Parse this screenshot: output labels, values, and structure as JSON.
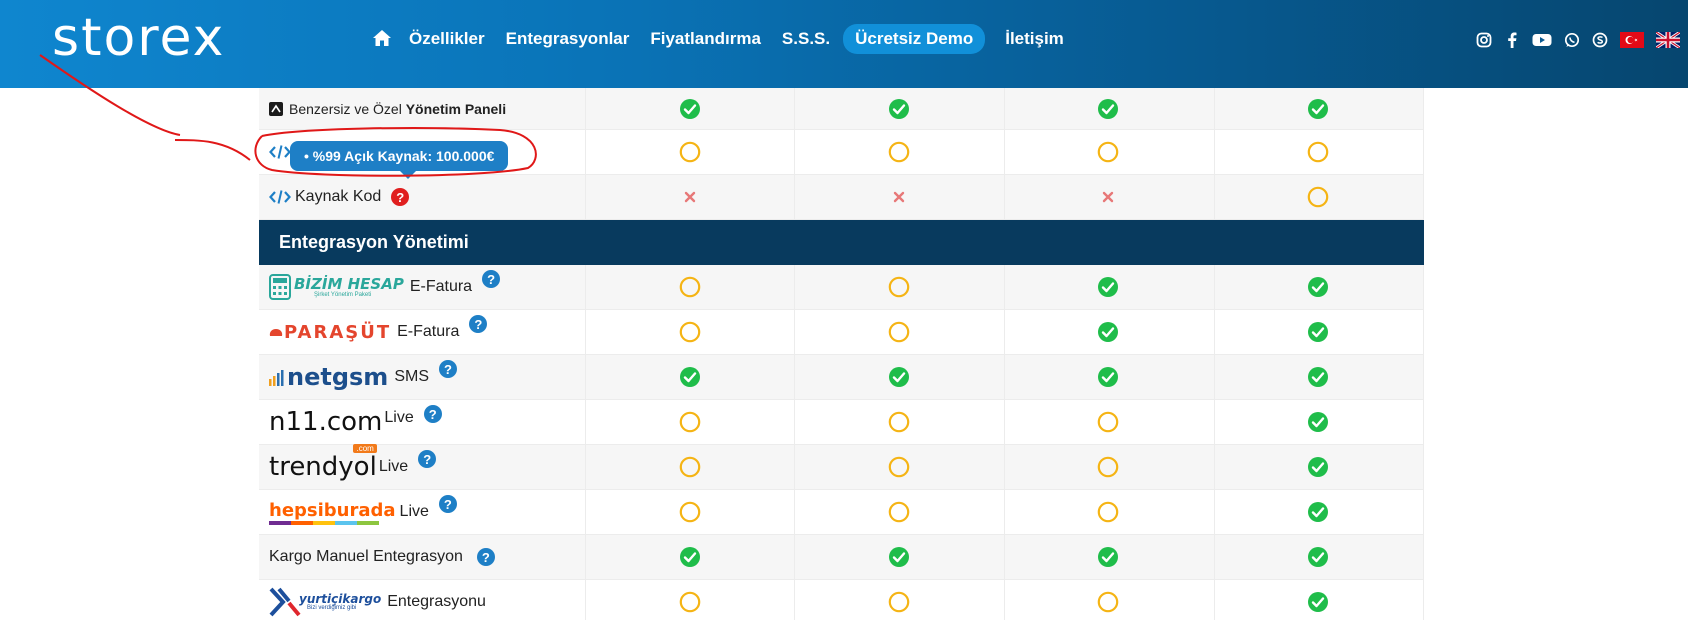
{
  "header": {
    "logo": "storex",
    "nav": {
      "features": "Özellikler",
      "integrations": "Entegrasyonlar",
      "pricing": "Fiyatlandırma",
      "faq": "S.S.S.",
      "demo": "Ücretsiz Demo",
      "contact": "İletişim"
    },
    "socials": [
      "instagram-icon",
      "facebook-icon",
      "youtube-icon",
      "whatsapp-icon",
      "skype-icon",
      "turkey-flag-icon",
      "uk-flag-icon"
    ]
  },
  "rows": {
    "panel": {
      "label_prefix": "Benzersiz ve Özel",
      "label_bold": "Yönetim Paneli",
      "marks": [
        "check",
        "check",
        "check",
        "check"
      ]
    },
    "opensource": {
      "marks": [
        "circle",
        "circle",
        "circle",
        "circle"
      ]
    },
    "source": {
      "label": "Kaynak Kod",
      "marks": [
        "cross",
        "cross",
        "cross",
        "circle"
      ]
    }
  },
  "tooltip": {
    "text": "• %99 Açık Kaynak: 100.000€"
  },
  "section": {
    "title": "Entegrasyon Yönetimi"
  },
  "integrations": [
    {
      "logo": "BİZİM HESAP",
      "logo_sub": "Şirket Yönetim Paketi",
      "label": "E-Fatura",
      "marks": [
        "circle",
        "circle",
        "check",
        "check"
      ]
    },
    {
      "logo": "PARAŞÜT",
      "label": "E-Fatura",
      "marks": [
        "circle",
        "circle",
        "check",
        "check"
      ]
    },
    {
      "logo": "netgsm",
      "label": "SMS",
      "marks": [
        "check",
        "check",
        "check",
        "check"
      ]
    },
    {
      "logo": "n11.com",
      "label": "Live",
      "marks": [
        "circle",
        "circle",
        "circle",
        "check"
      ]
    },
    {
      "logo": "trendyol",
      "logo_badge": ".com",
      "label": "Live",
      "marks": [
        "circle",
        "circle",
        "circle",
        "check"
      ]
    },
    {
      "logo": "hepsiburada",
      "label": "Live",
      "marks": [
        "circle",
        "circle",
        "circle",
        "check"
      ]
    },
    {
      "label": "Kargo Manuel Entegrasyon",
      "marks": [
        "check",
        "check",
        "check",
        "check"
      ]
    },
    {
      "logo": "yurtiçikargo",
      "logo_sub": "Bizi verdiğimiz gibi",
      "label": "Entegrasyonu",
      "marks": [
        "circle",
        "circle",
        "circle",
        "check"
      ]
    }
  ],
  "colors": {
    "header_start": "#0f86cf",
    "header_end": "#06466f",
    "section_bg": "#083a5e",
    "check": "#1fbd4a",
    "circle": "#f5b414",
    "cross": "#e77878",
    "tooltip": "#1e7fc6",
    "annotation": "#e01818"
  }
}
